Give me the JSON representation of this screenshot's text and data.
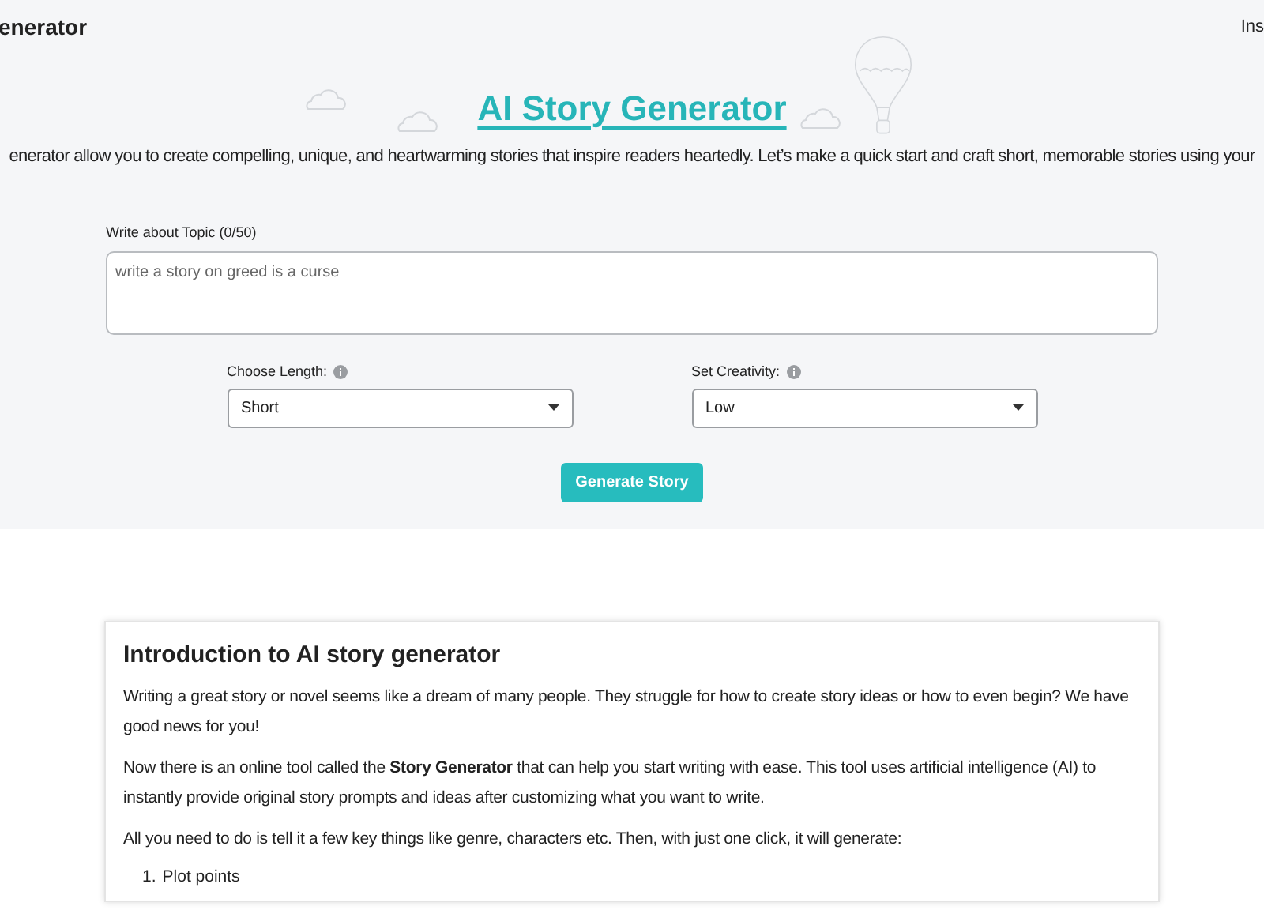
{
  "header": {
    "brand": "enerator",
    "nav_item": "Ins"
  },
  "hero": {
    "title": "AI Story Generator",
    "tagline": "enerator allow you to create compelling, unique, and heartwarming stories that inspire readers heartedly. Let’s make a quick start and craft short, memorable stories using your"
  },
  "form": {
    "topic_label": "Write about Topic (0/50)",
    "topic_placeholder": "write a story on greed is a curse",
    "selects": [
      {
        "label": "Choose Length:",
        "value": "Short"
      },
      {
        "label": "Set Creativity:",
        "value": "Low"
      }
    ],
    "button": "Generate Story"
  },
  "article": {
    "heading": "Introduction to AI story generator",
    "paragraphs": [
      "Writing a great story or novel seems like a dream of many people. They struggle for how to create story ideas or how to even begin? We have good news for you!",
      "Now there is an online tool called the **Story Generator** that can help you start writing with ease. This tool uses artificial intelligence (AI) to instantly provide original story prompts and ideas after customizing what you want to write.",
      "All you need to do is tell it a few key things like genre, characters etc. Then, with just one click, it will generate:"
    ],
    "list": [
      {
        "number": "1.",
        "text": "Plot points"
      }
    ]
  }
}
